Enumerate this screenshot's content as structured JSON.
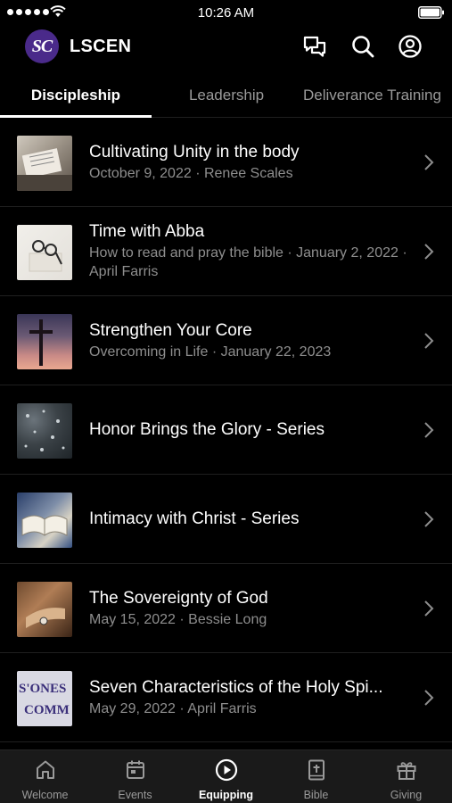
{
  "status_bar": {
    "time": "10:26 AM"
  },
  "header": {
    "logo_text": "SC",
    "app_name": "LSCEN",
    "icons": [
      "chat-icon",
      "search-icon",
      "profile-icon"
    ]
  },
  "tabs": [
    {
      "label": "Discipleship",
      "active": true
    },
    {
      "label": "Leadership",
      "active": false
    },
    {
      "label": "Deliverance Training",
      "active": false
    }
  ],
  "items": [
    {
      "title": "Cultivating Unity in the body",
      "subtitle": "October 9, 2022 · Renee Scales"
    },
    {
      "title": "Time with Abba",
      "subtitle": "How to read and pray the bible · January 2, 2022 · April Farris"
    },
    {
      "title": "Strengthen Your Core",
      "subtitle": "Overcoming in Life · January 22, 2023"
    },
    {
      "title": "Honor Brings the Glory - Series",
      "subtitle": ""
    },
    {
      "title": "Intimacy with Christ - Series",
      "subtitle": ""
    },
    {
      "title": "The Sovereignty of God",
      "subtitle": "May 15, 2022 · Bessie Long"
    },
    {
      "title": "Seven Characteristics of the Holy Spi...",
      "subtitle": "May 29, 2022 · April Farris",
      "thumb_text": [
        "S'ONES",
        "COMM"
      ]
    }
  ],
  "bottom_nav": [
    {
      "label": "Welcome",
      "icon": "home-icon",
      "active": false
    },
    {
      "label": "Events",
      "icon": "calendar-icon",
      "active": false
    },
    {
      "label": "Equipping",
      "icon": "play-circle-icon",
      "active": true
    },
    {
      "label": "Bible",
      "icon": "bible-icon",
      "active": false
    },
    {
      "label": "Giving",
      "icon": "gift-icon",
      "active": false
    }
  ],
  "colors": {
    "background": "#000000",
    "logo_bg": "#4a2a8a",
    "muted_text": "#8e8e8e",
    "nav_bg": "#1a1a1a"
  }
}
